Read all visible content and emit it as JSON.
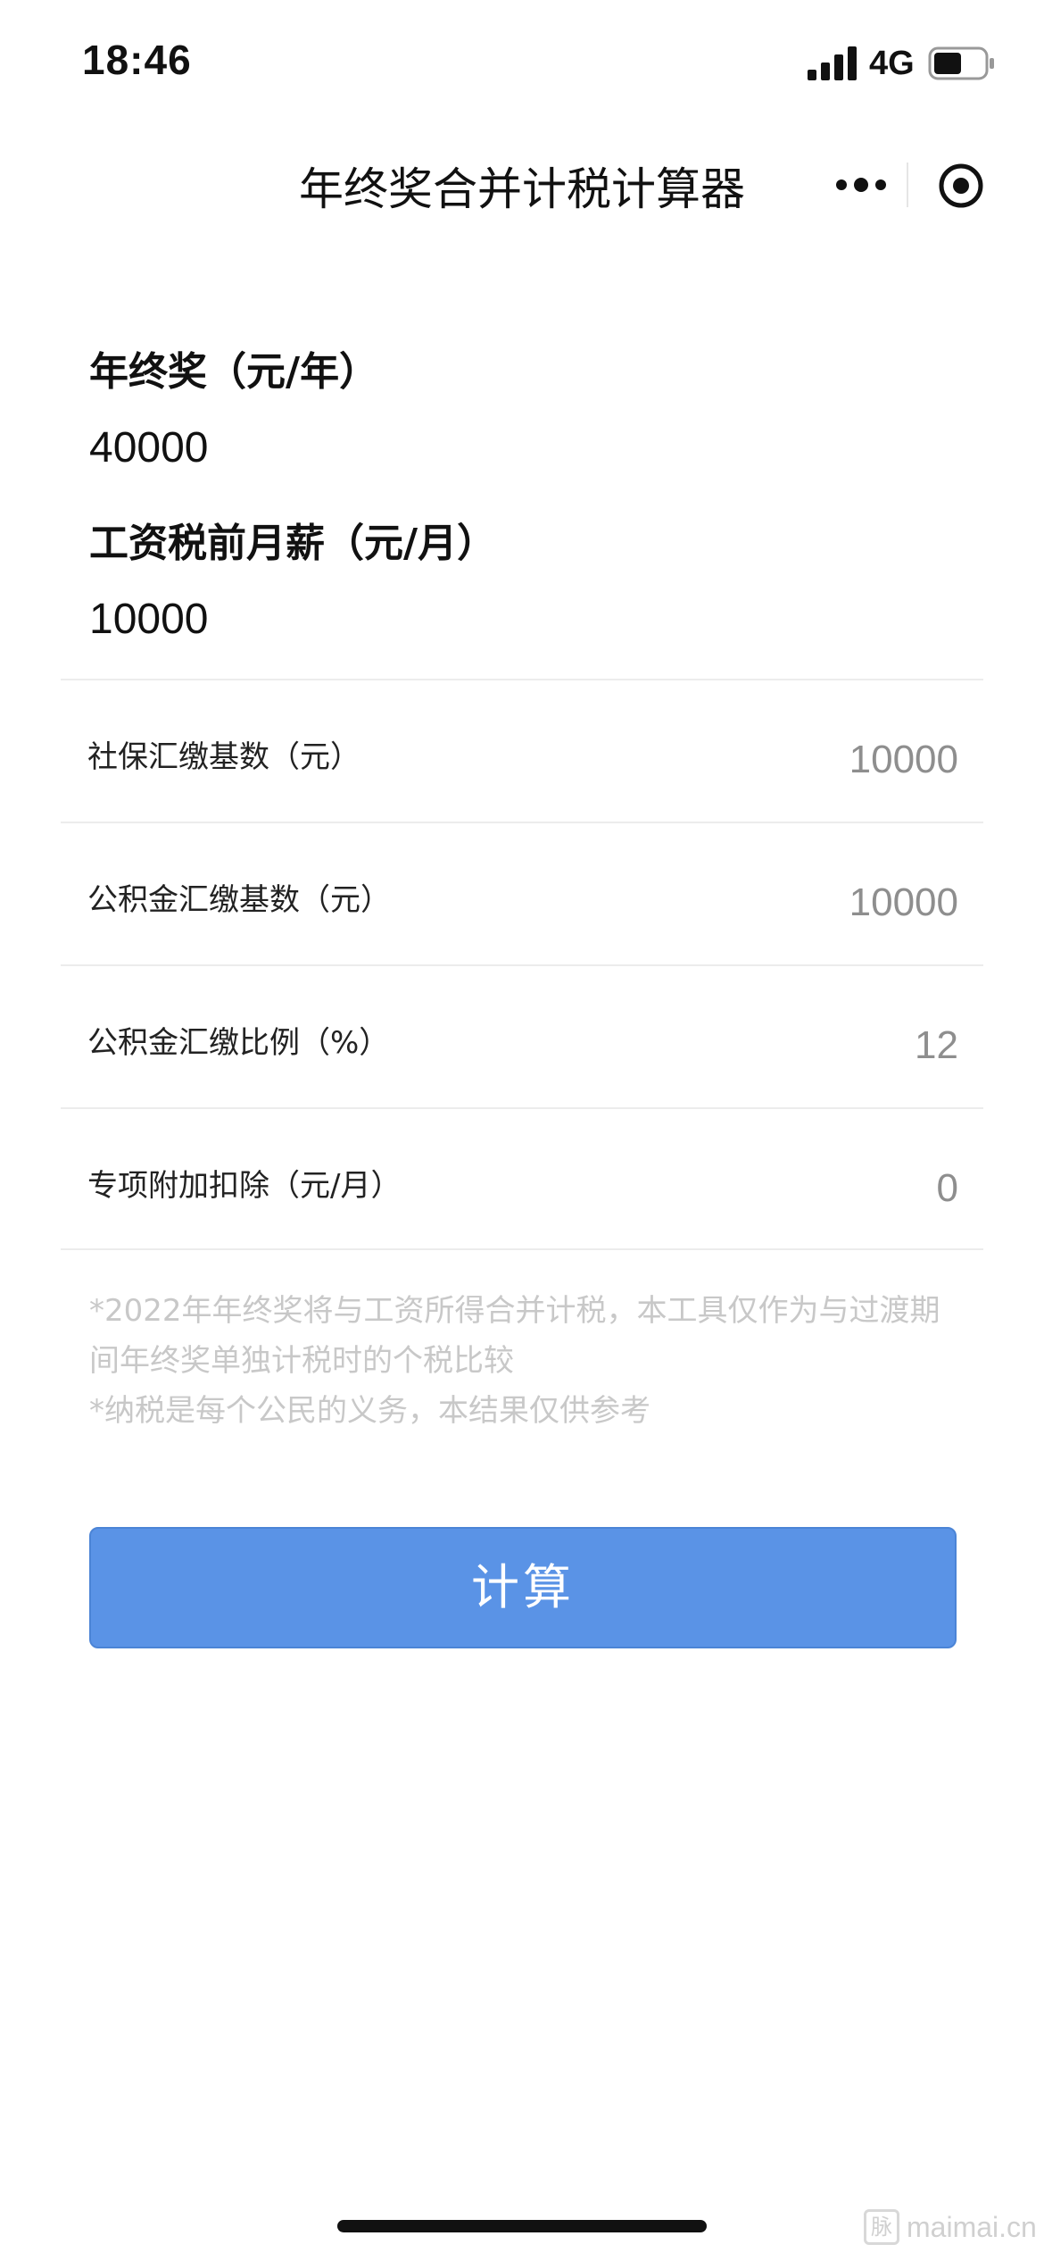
{
  "status_bar": {
    "time": "18:46",
    "network": "4G",
    "signal_icon": "signal-bars-icon",
    "battery_icon": "battery-icon",
    "battery_level": 0.55
  },
  "nav": {
    "title": "年终奖合并计税计算器",
    "more_icon": "more-dots-icon",
    "close_icon": "target-circle-icon"
  },
  "form": {
    "bonus_label": "年终奖（元/年）",
    "bonus_value": "40000",
    "salary_label": "工资税前月薪（元/月）",
    "salary_value": "10000",
    "rows": [
      {
        "label": "社保汇缴基数（元）",
        "value": "10000"
      },
      {
        "label": "公积金汇缴基数（元）",
        "value": "10000"
      },
      {
        "label": "公积金汇缴比例（%）",
        "value": "12"
      },
      {
        "label": "专项附加扣除（元/月）",
        "value": "0"
      }
    ]
  },
  "notes": {
    "line1": "*2022年年终奖将与工资所得合并计税，本工具仅作为与过渡期间年终奖单独计税时的个税比较",
    "line2": "*纳税是每个公民的义务，本结果仅供参考"
  },
  "button": {
    "calculate_label": "计算"
  },
  "watermark": {
    "badge": "脉",
    "text": "maimai.cn"
  },
  "colors": {
    "button_bg": "#5a93e6",
    "placeholder_gray": "#8e8e8e",
    "note_gray": "#c8c8c8"
  }
}
